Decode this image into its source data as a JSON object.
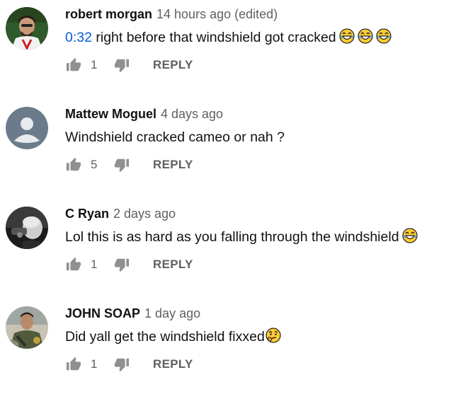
{
  "colors": {
    "author": "#111111",
    "meta": "#606060",
    "timestamp_link": "#065fd4"
  },
  "comments": [
    {
      "author": "robert morgan",
      "meta": "14 hours ago (edited)",
      "timestamp_link": "0:32",
      "text": " right before that windshield got cracked",
      "emojis": [
        "laughing-emoji",
        "laughing-emoji",
        "laughing-emoji"
      ],
      "likes": "1",
      "reply_label": "REPLY",
      "avatar": "user-photo-avatar"
    },
    {
      "author": "Mattew Moguel",
      "meta": "4 days ago",
      "timestamp_link": "",
      "text": "Windshield cracked cameo or nah ?",
      "emojis": [],
      "likes": "5",
      "reply_label": "REPLY",
      "avatar": "default-avatar"
    },
    {
      "author": "C Ryan",
      "meta": "2 days ago",
      "timestamp_link": "",
      "text": "Lol this is as hard as you falling through the windshield",
      "emojis": [
        "laughing-emoji"
      ],
      "likes": "1",
      "reply_label": "REPLY",
      "avatar": "user-photo-avatar"
    },
    {
      "author": "JOHN SOAP",
      "meta": "1 day ago",
      "timestamp_link": "",
      "text": "Did yall get the windshield fixxed",
      "emojis": [
        "thinking-emoji"
      ],
      "likes": "1",
      "reply_label": "REPLY",
      "avatar": "user-photo-avatar"
    }
  ]
}
